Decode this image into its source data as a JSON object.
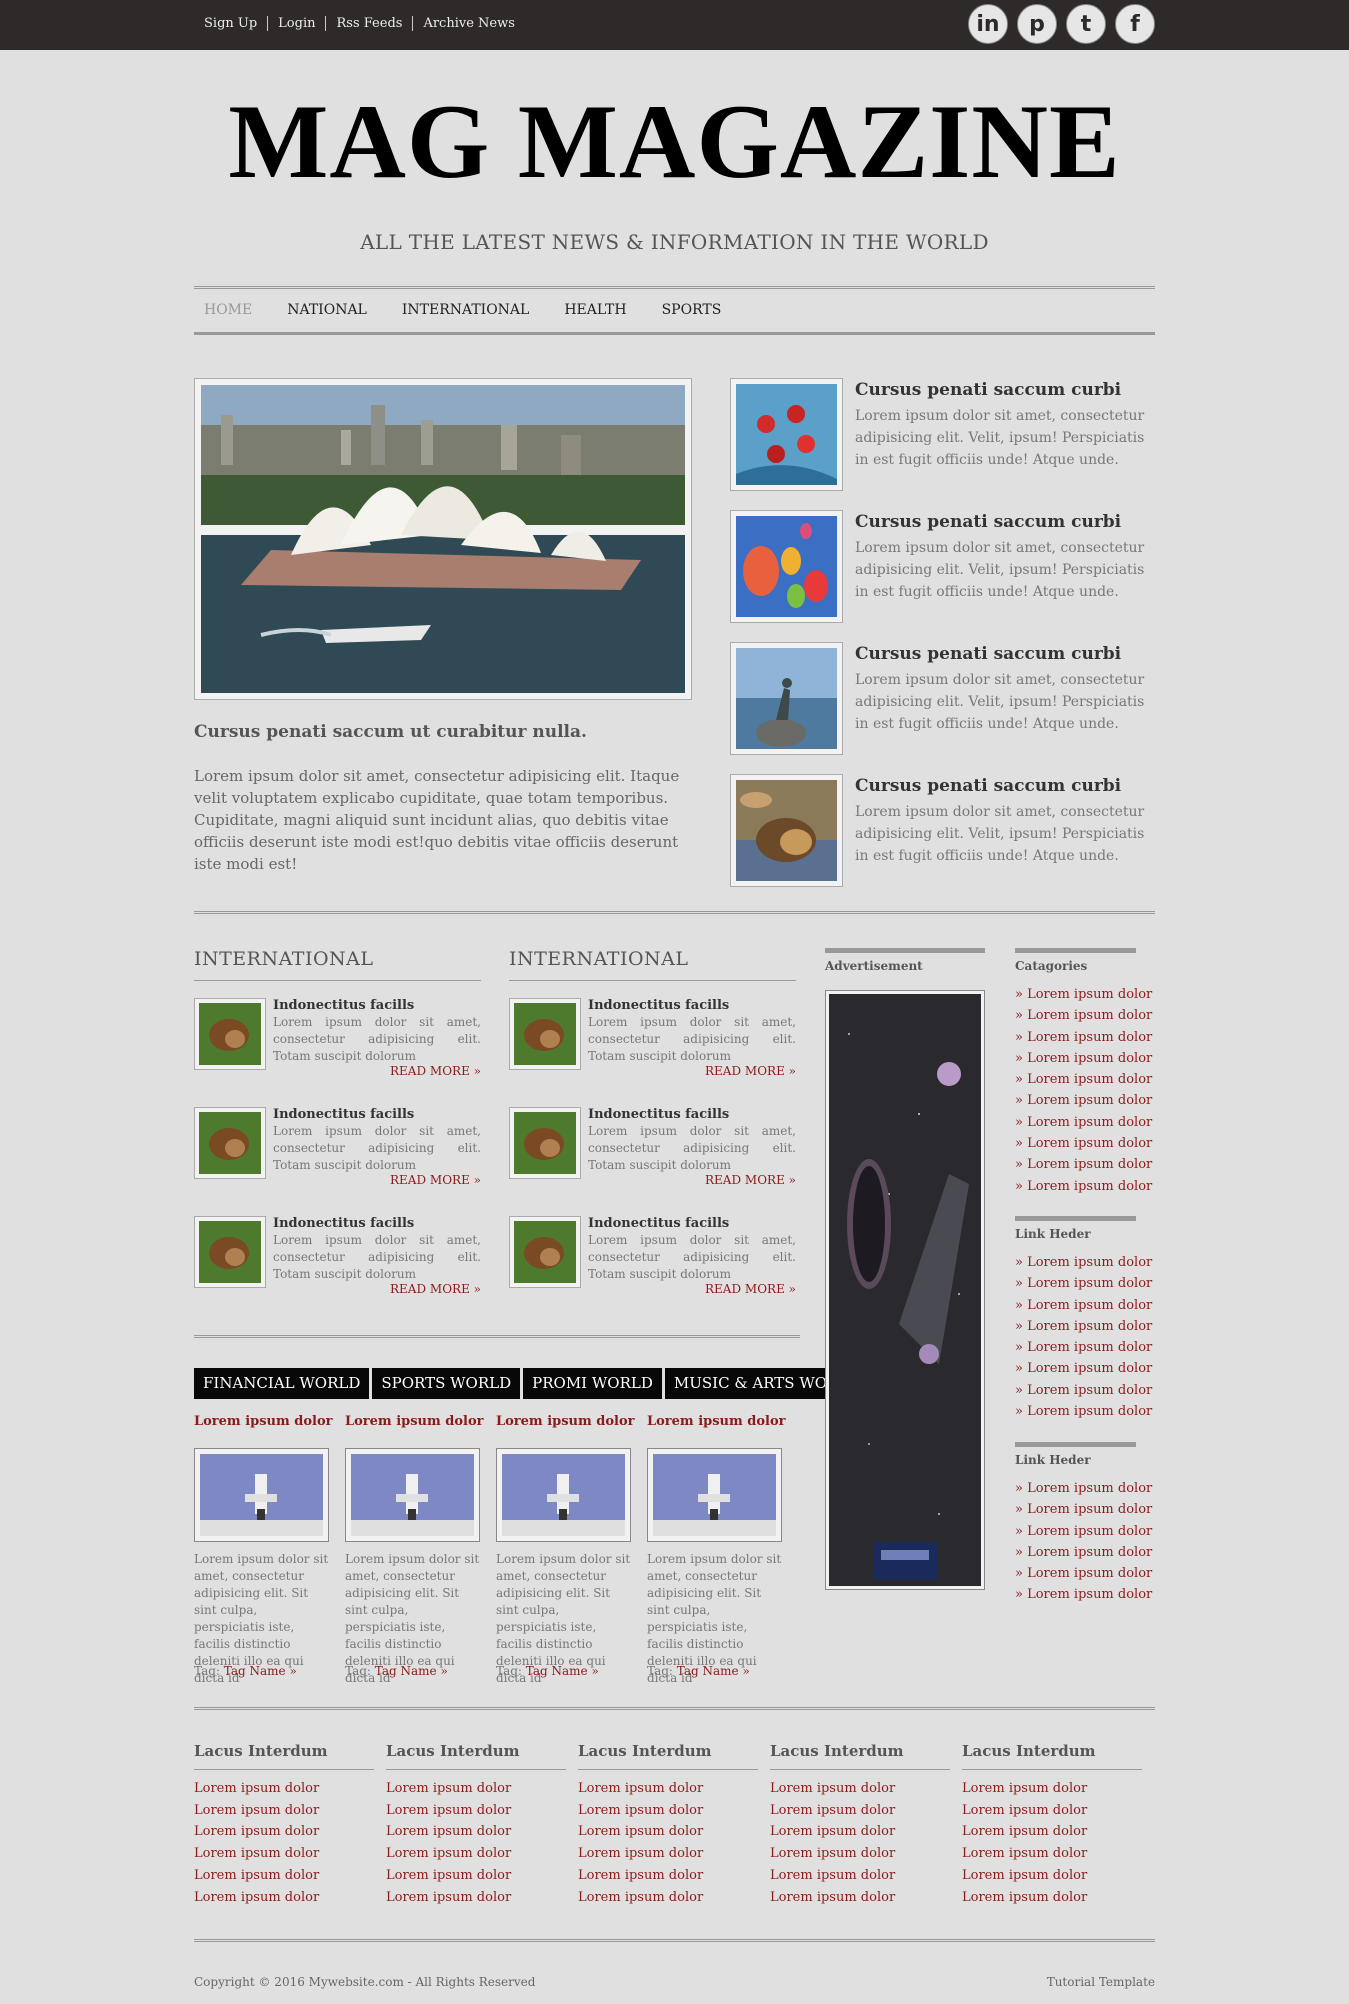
{
  "topbar": {
    "links": [
      "Sign Up",
      "Login",
      "Rss Feeds",
      "Archive News"
    ],
    "social": [
      {
        "icon": "linkedin-icon",
        "glyph": "in"
      },
      {
        "icon": "pinterest-icon",
        "glyph": "p"
      },
      {
        "icon": "tumblr-icon",
        "glyph": "t"
      },
      {
        "icon": "facebook-icon",
        "glyph": "f"
      }
    ]
  },
  "header": {
    "logo": "MAG MAGAZINE",
    "tagline": "ALL THE LATEST NEWS & INFORMATION IN THE WORLD"
  },
  "nav": {
    "items": [
      "HOME",
      "NATIONAL",
      "INTERNATIONAL",
      "HEALTH",
      "SPORTS"
    ]
  },
  "featured": {
    "title": "Cursus penati saccum ut curabitur nulla.",
    "text": "Lorem ipsum dolor sit amet, consectetur adipisicing elit. Itaque velit voluptatem explicabo cupiditate, quae totam temporibus. Cupiditate, magni aliquid sunt incidunt alias, quo debitis vitae officiis deserunt iste modi est!quo debitis vitae officiis deserunt iste modi est!"
  },
  "side_articles": [
    {
      "title": "Cursus penati saccum curbi",
      "text": "Lorem ipsum dolor sit amet, consectetur adipisicing elit. Velit, ipsum! Perspiciatis in est fugit officiis unde! Atque unde."
    },
    {
      "title": "Cursus penati saccum curbi",
      "text": "Lorem ipsum dolor sit amet, consectetur adipisicing elit. Velit, ipsum! Perspiciatis in est fugit officiis unde! Atque unde."
    },
    {
      "title": "Cursus penati saccum curbi",
      "text": "Lorem ipsum dolor sit amet, consectetur adipisicing elit. Velit, ipsum! Perspiciatis in est fugit officiis unde! Atque unde."
    },
    {
      "title": "Cursus penati saccum curbi",
      "text": "Lorem ipsum dolor sit amet, consectetur adipisicing elit. Velit, ipsum! Perspiciatis in est fugit officiis unde! Atque unde."
    }
  ],
  "international": [
    {
      "heading": "INTERNATIONAL",
      "items": [
        {
          "title": "Indonectitus facills",
          "text": "Lorem ipsum dolor sit amet, consectetur adipisicing elit. Totam suscipit dolorum",
          "more": "READ MORE »"
        },
        {
          "title": "Indonectitus facills",
          "text": "Lorem ipsum dolor sit amet, consectetur adipisicing elit. Totam suscipit dolorum",
          "more": "READ MORE »"
        },
        {
          "title": "Indonectitus facills",
          "text": "Lorem ipsum dolor sit amet, consectetur adipisicing elit. Totam suscipit dolorum",
          "more": "READ MORE »"
        }
      ]
    },
    {
      "heading": "INTERNATIONAL",
      "items": [
        {
          "title": "Indonectitus facills",
          "text": "Lorem ipsum dolor sit amet, consectetur adipisicing elit. Totam suscipit dolorum",
          "more": "READ MORE »"
        },
        {
          "title": "Indonectitus facills",
          "text": "Lorem ipsum dolor sit amet, consectetur adipisicing elit. Totam suscipit dolorum",
          "more": "READ MORE »"
        },
        {
          "title": "Indonectitus facills",
          "text": "Lorem ipsum dolor sit amet, consectetur adipisicing elit. Totam suscipit dolorum",
          "more": "READ MORE »"
        }
      ]
    }
  ],
  "world_tabs": [
    "FINANCIAL WORLD",
    "SPORTS WORLD",
    "PROMI WORLD",
    "MUSIC & ARTS WORLD"
  ],
  "world_items": [
    {
      "title": "Lorem ipsum dolor",
      "text": "Lorem ipsum dolor sit amet, consectetur adipisicing elit. Sit sint culpa, perspiciatis iste, facilis distinctio deleniti illo ea qui dicta id",
      "tag_label": "Tag:",
      "tag_name": "Tag Name »"
    },
    {
      "title": "Lorem ipsum dolor",
      "text": "Lorem ipsum dolor sit amet, consectetur adipisicing elit. Sit sint culpa, perspiciatis iste, facilis distinctio deleniti illo ea qui dicta id",
      "tag_label": "Tag:",
      "tag_name": "Tag Name »"
    },
    {
      "title": "Lorem ipsum dolor",
      "text": "Lorem ipsum dolor sit amet, consectetur adipisicing elit. Sit sint culpa, perspiciatis iste, facilis distinctio deleniti illo ea qui dicta id",
      "tag_label": "Tag:",
      "tag_name": "Tag Name »"
    },
    {
      "title": "Lorem ipsum dolor",
      "text": "Lorem ipsum dolor sit amet, consectetur adipisicing elit. Sit sint culpa, perspiciatis iste, facilis distinctio deleniti illo ea qui dicta id",
      "tag_label": "Tag:",
      "tag_name": "Tag Name »"
    }
  ],
  "sidebar": {
    "advertisement": "Advertisement",
    "blocks": [
      {
        "heading": "Catagories",
        "items": [
          "» Lorem ipsum dolor",
          "» Lorem ipsum dolor",
          "» Lorem ipsum dolor",
          "» Lorem ipsum dolor",
          "» Lorem ipsum dolor",
          "» Lorem ipsum dolor",
          "» Lorem ipsum dolor",
          "» Lorem ipsum dolor",
          "» Lorem ipsum dolor",
          "» Lorem ipsum dolor"
        ]
      },
      {
        "heading": "Link Heder",
        "items": [
          "» Lorem ipsum dolor",
          "» Lorem ipsum dolor",
          "» Lorem ipsum dolor",
          "» Lorem ipsum dolor",
          "» Lorem ipsum dolor",
          "» Lorem ipsum dolor",
          "» Lorem ipsum dolor",
          "» Lorem ipsum dolor"
        ]
      },
      {
        "heading": "Link Heder",
        "items": [
          "» Lorem ipsum dolor",
          "» Lorem ipsum dolor",
          "» Lorem ipsum dolor",
          "» Lorem ipsum dolor",
          "» Lorem ipsum dolor",
          "» Lorem ipsum dolor"
        ]
      }
    ]
  },
  "footer_cols": [
    {
      "heading": "Lacus Interdum",
      "items": [
        "Lorem ipsum dolor",
        "Lorem ipsum dolor",
        "Lorem ipsum dolor",
        "Lorem ipsum dolor",
        "Lorem ipsum dolor",
        "Lorem ipsum dolor"
      ]
    },
    {
      "heading": "Lacus Interdum",
      "items": [
        "Lorem ipsum dolor",
        "Lorem ipsum dolor",
        "Lorem ipsum dolor",
        "Lorem ipsum dolor",
        "Lorem ipsum dolor",
        "Lorem ipsum dolor"
      ]
    },
    {
      "heading": "Lacus Interdum",
      "items": [
        "Lorem ipsum dolor",
        "Lorem ipsum dolor",
        "Lorem ipsum dolor",
        "Lorem ipsum dolor",
        "Lorem ipsum dolor",
        "Lorem ipsum dolor"
      ]
    },
    {
      "heading": "Lacus Interdum",
      "items": [
        "Lorem ipsum dolor",
        "Lorem ipsum dolor",
        "Lorem ipsum dolor",
        "Lorem ipsum dolor",
        "Lorem ipsum dolor",
        "Lorem ipsum dolor"
      ]
    },
    {
      "heading": "Lacus Interdum",
      "items": [
        "Lorem ipsum dolor",
        "Lorem ipsum dolor",
        "Lorem ipsum dolor",
        "Lorem ipsum dolor",
        "Lorem ipsum dolor",
        "Lorem ipsum dolor"
      ]
    }
  ],
  "footer": {
    "copyright": "Copyright © 2016 Mywebsite.com - All Rights Reserved",
    "credit": "Tutorial Template"
  },
  "colors": {
    "topbar": "#2e2a29",
    "background": "#e0e0e0",
    "link_red": "#8b1a1a",
    "tab_black": "#080808"
  }
}
